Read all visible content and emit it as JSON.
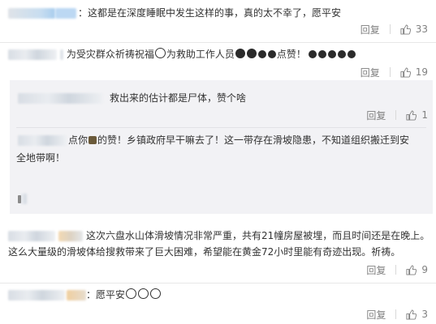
{
  "comments": [
    {
      "text": "：这都是在深度睡眠中发生这样的事，真的太不幸了，愿平安",
      "reply_label": "回复",
      "likes": "33"
    },
    {
      "text_a": "为受灾群众祈祷祝福",
      "text_b": "为救助工作人员",
      "text_c": "点赞！",
      "reply_label": "回复",
      "likes": "19"
    },
    {
      "text": "救出来的估计都是尸体，赞个啥",
      "reply_label": "回复",
      "likes": "1",
      "sub": true
    },
    {
      "text_a": "点你",
      "text_b": "的赞！乡镇政府早干嘛去了！这一带存在滑坡隐患，不知道组织搬迁到安",
      "text_line2": "全地带啊！",
      "sub": true
    },
    {
      "line1": "这次六盘水山体滑坡情况非常严重，共有21幢房屋被埋，而且时间还是在晚上。",
      "line2": "这么大量级的滑坡体给搜救带来了巨大困难，希望能在黄金72小时里能有奇迹出现。祈祷。",
      "reply_label": "回复",
      "likes": "9"
    },
    {
      "text": "：愿平安",
      "reply_label": "回复",
      "likes": "3"
    }
  ],
  "icons": {
    "like": "thumbs-up-icon",
    "emoji_pray": "pray-emoji-icon",
    "emoji_salute": "salute-emoji-icon",
    "emoji_thumb": "thumb-emoji-icon",
    "emoji_candle": "candle-emoji-icon"
  },
  "colors": {
    "text": "#333333",
    "muted": "#808080",
    "subpanel_bg": "#f2f2f5",
    "divider": "#e8e8e8"
  }
}
